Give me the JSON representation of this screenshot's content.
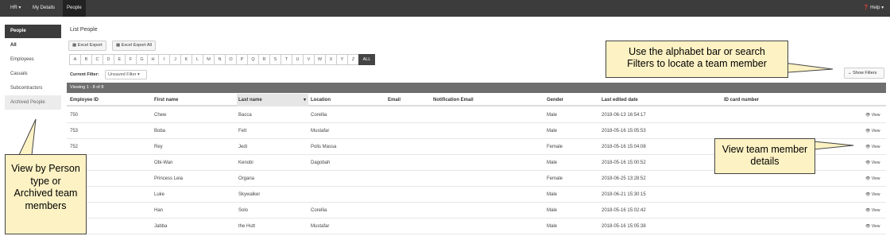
{
  "topbar": {
    "hr": "HR ▾",
    "my_details": "My Details",
    "people": "People",
    "help": "❓ Help ▾"
  },
  "sidebar": {
    "heading": "People",
    "items": [
      {
        "label": "All"
      },
      {
        "label": "Employees"
      },
      {
        "label": "Casuals"
      },
      {
        "label": "Subcontractors"
      },
      {
        "label": "Archived People"
      }
    ]
  },
  "main": {
    "title": "List People",
    "excel_export": "Excel Export",
    "excel_export_all": "Excel Export All",
    "alphabet": [
      "A",
      "B",
      "C",
      "D",
      "E",
      "F",
      "G",
      "H",
      "I",
      "J",
      "K",
      "L",
      "M",
      "N",
      "O",
      "P",
      "Q",
      "R",
      "S",
      "T",
      "U",
      "V",
      "W",
      "X",
      "Y",
      "Z",
      "ALL"
    ],
    "current_filter_label": "Current Filter:",
    "current_filter_value": "Unsaved Filter",
    "show_filters": "Show Filters",
    "viewing": "Viewing 1 - 8 of 8"
  },
  "table": {
    "headers": [
      "Employee ID",
      "First name",
      "Last name",
      "Location",
      "Email",
      "Notification Email",
      "Gender",
      "Last edited date",
      "ID card number"
    ],
    "rows": [
      {
        "id": "750",
        "first": "Chew",
        "last": "Bacca",
        "location": "Corellia",
        "gender": "Male",
        "edited": "2018-06-13 16:54:17",
        "view": "View"
      },
      {
        "id": "753",
        "first": "Boba",
        "last": "Fett",
        "location": "Mustafar",
        "gender": "Male",
        "edited": "2018-05-16 15:05:53",
        "view": "View"
      },
      {
        "id": "752",
        "first": "Rey",
        "last": "Jedi",
        "location": "Polis Massa",
        "gender": "Female",
        "edited": "2018-05-16 15:04:08",
        "view": "View"
      },
      {
        "id": "",
        "first": "Obi-Wan",
        "last": "Kenobi",
        "location": "Dagobah",
        "gender": "Male",
        "edited": "2018-05-16 15:00:52",
        "view": "View"
      },
      {
        "id": "",
        "first": "Princess Leia",
        "last": "Organa",
        "location": "",
        "gender": "Female",
        "edited": "2018-06-25 13:28:52",
        "view": "View"
      },
      {
        "id": "",
        "first": "Luke",
        "last": "Skywalker",
        "location": "",
        "gender": "Male",
        "edited": "2018-06-21 15:30:15",
        "view": "View"
      },
      {
        "id": "",
        "first": "Han",
        "last": "Solo",
        "location": "Corellia",
        "gender": "Male",
        "edited": "2018-05-16 15:02:42",
        "view": "View"
      },
      {
        "id": "",
        "first": "Jabba",
        "last": "the Hutt",
        "location": "Mustafar",
        "gender": "Male",
        "edited": "2018-05-16 15:05:38",
        "view": "View"
      }
    ]
  },
  "callouts": {
    "alphabet": "Use the alphabet  bar or search Filters to locate a team member",
    "view": "View team member details",
    "person_type": "View by Person type or Archived team members"
  }
}
